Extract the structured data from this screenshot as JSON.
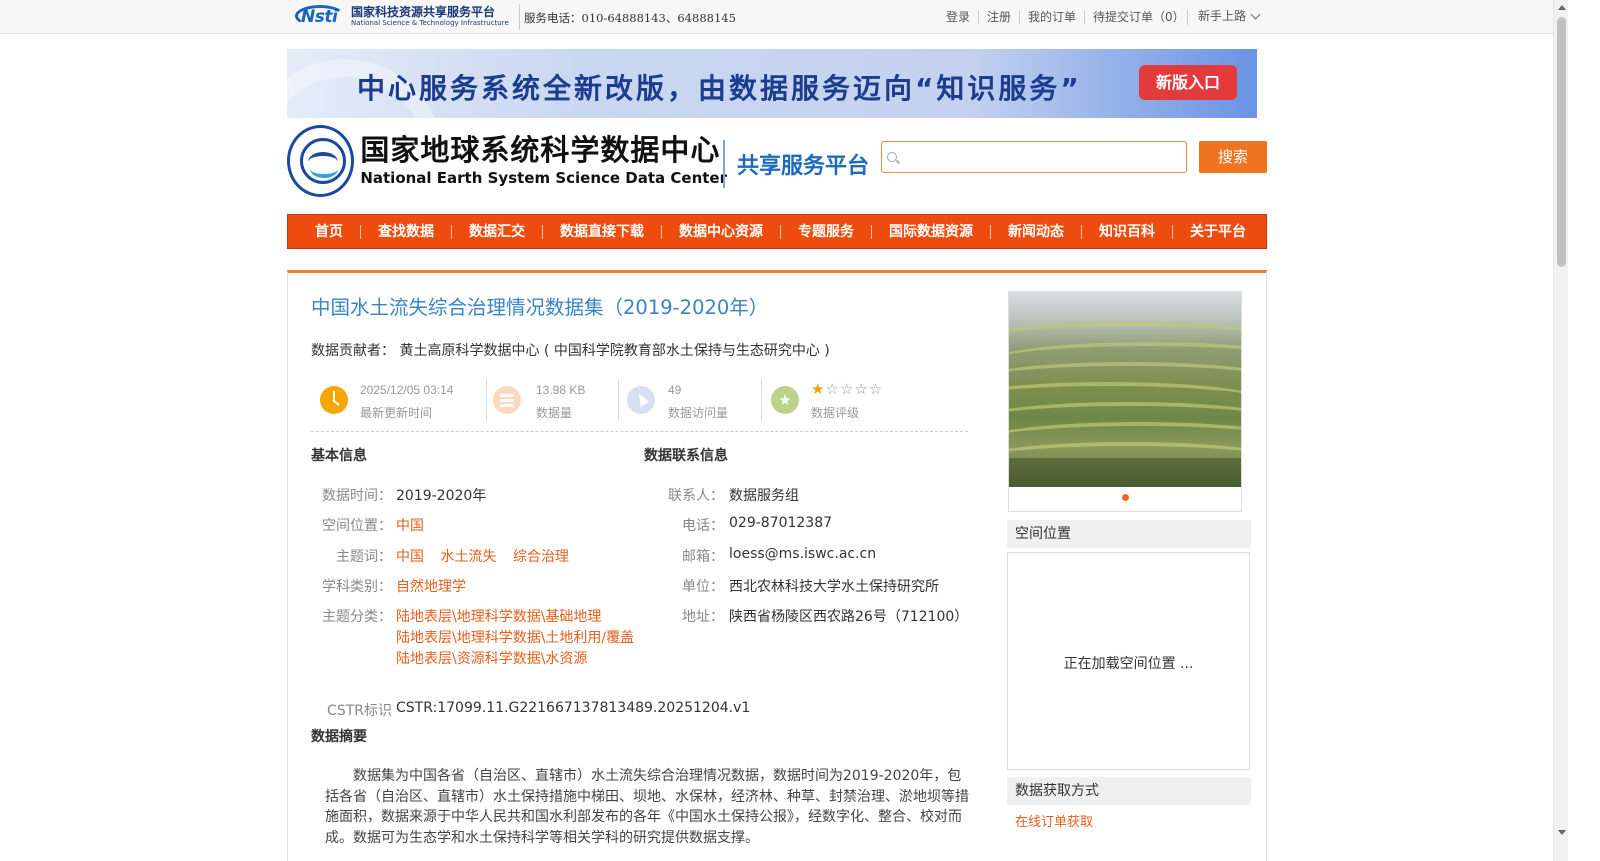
{
  "topbar": {
    "logo_cn": "国家科技资源共享服务平台",
    "logo_en": "National Science & Technology Infrastructure",
    "logo_mark": "Nsti",
    "service_phone": "服务电话：010-64888143、64888145",
    "links": [
      "登录",
      "注册",
      "我的订单",
      "待提交订单（0）"
    ],
    "newbie": "新手上路"
  },
  "banner": {
    "text": "中心服务系统全新改版，由数据服务迈向“知识服务”",
    "button": "新版入口"
  },
  "header": {
    "org_cn": "国家地球系统科学数据中心",
    "org_en": "National Earth System Science Data Center",
    "platform": "共享服务平台",
    "search_placeholder": "",
    "search_button": "搜索"
  },
  "nav": [
    "首页",
    "查找数据",
    "数据汇交",
    "数据直接下载",
    "数据中心资源",
    "专题服务",
    "国际数据资源",
    "新闻动态",
    "知识百科",
    "关于平台"
  ],
  "dataset": {
    "title": "中国水土流失综合治理情况数据集（2019-2020年）",
    "contributor_label": "数据贡献者：",
    "contributor": "黄土高原科学数据中心 ( 中国科学院教育部水土保持与生态研究中心 )",
    "stats": {
      "updated": {
        "value": "2025/12/05 03:14",
        "label": "最新更新时间"
      },
      "size": {
        "value": "13.98 KB",
        "label": "数据量"
      },
      "visits": {
        "value": "49",
        "label": "数据访问量"
      },
      "rating": {
        "value": 1,
        "max": 5,
        "label": "数据评级"
      }
    },
    "basic": {
      "heading": "基本信息",
      "time_label": "数据时间：",
      "time": "2019-2020年",
      "space_label": "空间位置：",
      "space": "中国",
      "keywords_label": "主题词：",
      "keywords": [
        "中国",
        "水土流失",
        "综合治理"
      ],
      "discipline_label": "学科类别：",
      "discipline": "自然地理学",
      "category_label": "主题分类：",
      "categories": [
        "陆地表层\\地理科学数据\\基础地理",
        "陆地表层\\地理科学数据\\土地利用/覆盖",
        "陆地表层\\资源科学数据\\水资源"
      ],
      "cstr_label": "CSTR标识",
      "cstr": "CSTR:17099.11.G221667137813489.20251204.v1"
    },
    "contact": {
      "heading": "数据联系信息",
      "person_label": "联系人：",
      "person": "数据服务组",
      "phone_label": "电话：",
      "phone": "029-87012387",
      "email_label": "邮箱：",
      "email": "loess@ms.iswc.ac.cn",
      "unit_label": "单位：",
      "unit": "西北农林科技大学水土保持研究所",
      "address_label": "地址：",
      "address": "陕西省杨陵区西农路26号（712100）"
    },
    "abstract_heading": "数据摘要",
    "abstract": "数据集为中国各省（自治区、直辖市）水土流失综合治理情况数据，数据时间为2019-2020年，包括各省（自治区、直辖市）水土保持措施中梯田、坝地、水保林，经济林、种草、封禁治理、淤地坝等措施面积，数据来源于中华人民共和国水利部发布的各年《中国水土保持公报》，经数字化、整合、校对而成。数据可为生态学和水土保持科学等相关学科的研究提供数据支撑。"
  },
  "sidebar": {
    "spatial_heading": "空间位置",
    "loading": "正在加载空间位置 ...",
    "access_heading": "数据获取方式",
    "order_link": "在线订单获取"
  },
  "colors": {
    "nav_bg": "#ee4b0f",
    "title_blue": "#3a83c6",
    "link_orange": "#e4601c",
    "search_btn": "#f07320"
  }
}
